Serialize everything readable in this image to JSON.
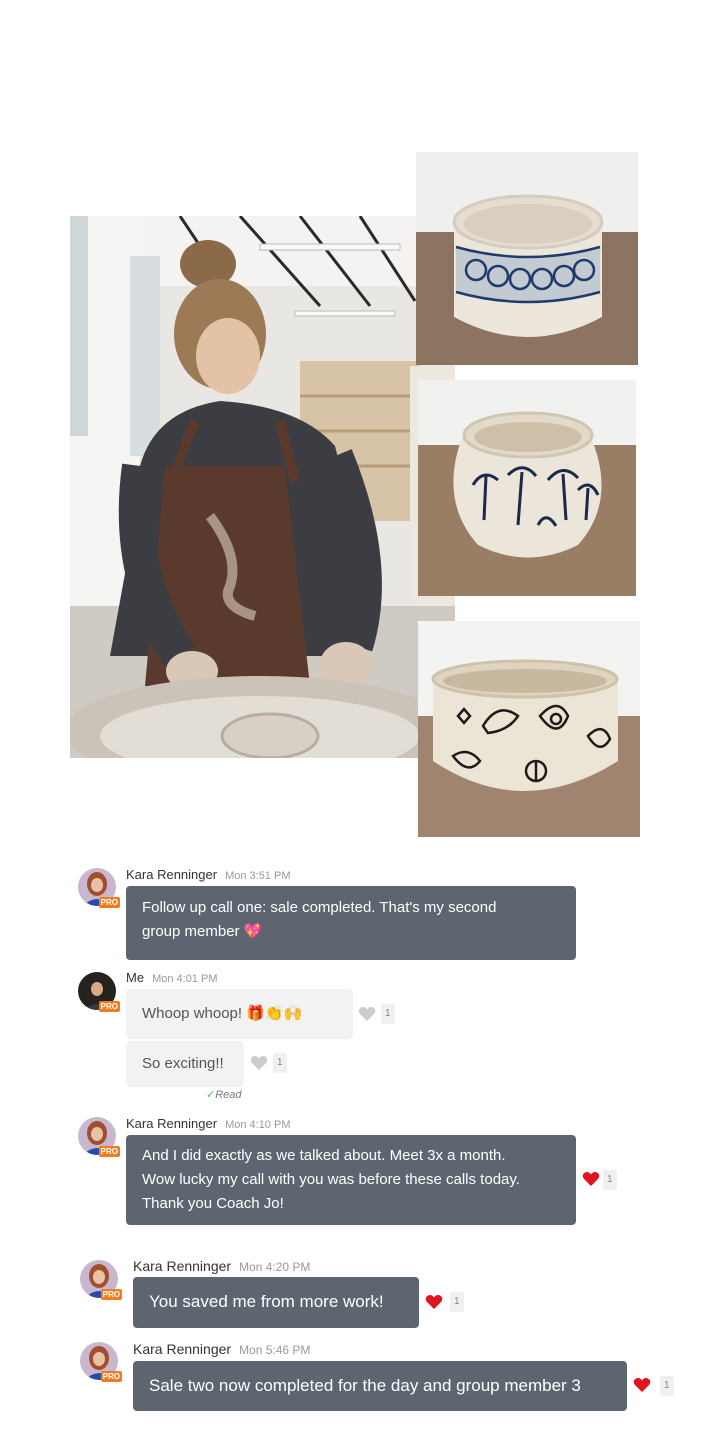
{
  "messages": [
    {
      "sender": "Kara Renninger",
      "time": "Mon 3:51 PM",
      "badge": "PRO",
      "lines": [
        "Follow up call one: sale completed.  That's my second",
        "group member"
      ],
      "emoji": "💖"
    },
    {
      "sender": "Me",
      "time": "Mon 4:01 PM",
      "badge": "PRO",
      "bubbles": [
        {
          "text": "Whoop whoop!",
          "emoji": "🎁👏🙌",
          "likes": "1"
        },
        {
          "text": "So exciting!!",
          "likes": "1"
        }
      ],
      "read": "Read"
    },
    {
      "sender": "Kara Renninger",
      "time": "Mon 4:10 PM",
      "badge": "PRO",
      "lines": [
        "And I did exactly as we talked about.  Meet 3x a month.",
        "Wow lucky my call with you was before these calls today.",
        "Thank you Coach Jo!"
      ],
      "likes": "1"
    },
    {
      "sender": "Kara Renninger",
      "time": "Mon 4:20 PM",
      "badge": "PRO",
      "lines": [
        "You saved me from more work!"
      ],
      "likes": "1"
    },
    {
      "sender": "Kara Renninger",
      "time": "Mon 5:46 PM",
      "badge": "PRO",
      "lines": [
        "Sale two now completed for the day and group member 3"
      ],
      "likes": "1"
    }
  ],
  "colors": {
    "bubble_other": "#5d6670",
    "bubble_me": "#f2f2f2",
    "heart_liked": "#e0141e",
    "heart_unliked": "#cccccc",
    "pro_badge": "#f07c1e"
  },
  "icons": [
    "heart-icon",
    "check-icon"
  ]
}
